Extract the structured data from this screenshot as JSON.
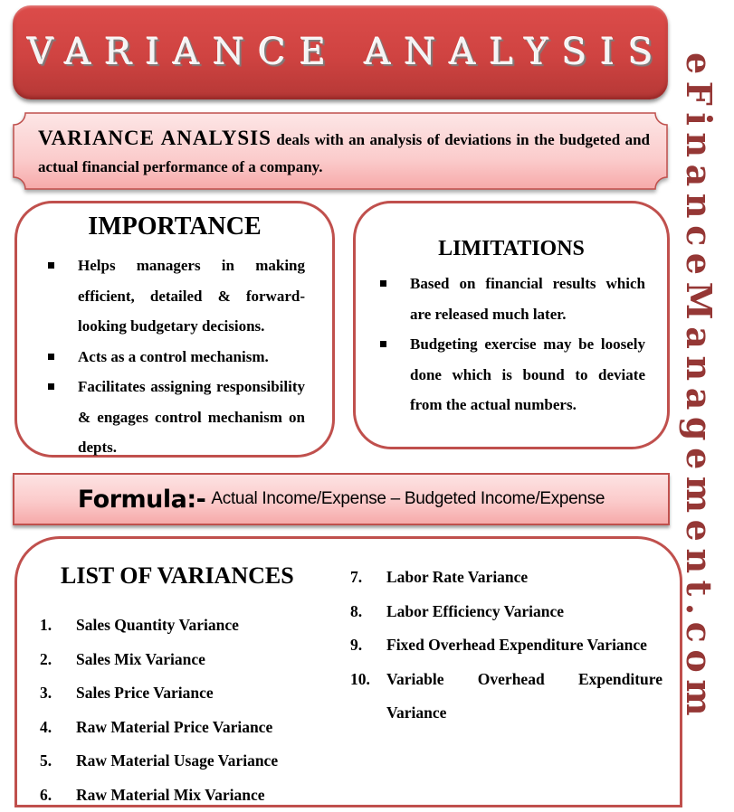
{
  "header": {
    "title": "VARIANCE ANALYSIS"
  },
  "intro": {
    "lead": "VARIANCE ANALYSIS",
    "text": " deals with an analysis of deviations in the budgeted and actual financial performance of a company."
  },
  "importance": {
    "title": "IMPORTANCE",
    "items": [
      "Helps managers in making efficient, detailed & forward-looking budgetary decisions.",
      "Acts as a control mechanism.",
      "Facilitates assigning responsibility & engages control mechanism on depts."
    ]
  },
  "limitations": {
    "title": "LIMITATIONS",
    "items": [
      "Based on financial results which are released much later.",
      "Budgeting exercise may be loosely done which is bound to deviate from the actual numbers."
    ]
  },
  "formula": {
    "label": "Formula:-",
    "value": "Actual Income/Expense – Budgeted Income/Expense"
  },
  "variances": {
    "title": "LIST OF VARIANCES",
    "items": [
      {
        "num": "1.",
        "label": "Sales Quantity Variance"
      },
      {
        "num": "2.",
        "label": "Sales Mix Variance"
      },
      {
        "num": "3.",
        "label": "Sales Price Variance"
      },
      {
        "num": "4.",
        "label": "Raw Material Price Variance"
      },
      {
        "num": "5.",
        "label": "Raw Material Usage Variance"
      },
      {
        "num": "6.",
        "label": "Raw Material Mix Variance"
      },
      {
        "num": "7.",
        "label": "Labor Rate Variance"
      },
      {
        "num": "8.",
        "label": "Labor Efficiency Variance"
      },
      {
        "num": "9.",
        "label": "Fixed Overhead Expenditure Variance"
      },
      {
        "num": "10.",
        "label": "Variable Overhead Expenditure Variance"
      }
    ]
  },
  "brand": {
    "text": "eFinanceManagement.com",
    "color": "#953735"
  },
  "colors": {
    "accent": "#c0504d",
    "header": "#d04442",
    "panel_fill": "#fbcaca"
  }
}
